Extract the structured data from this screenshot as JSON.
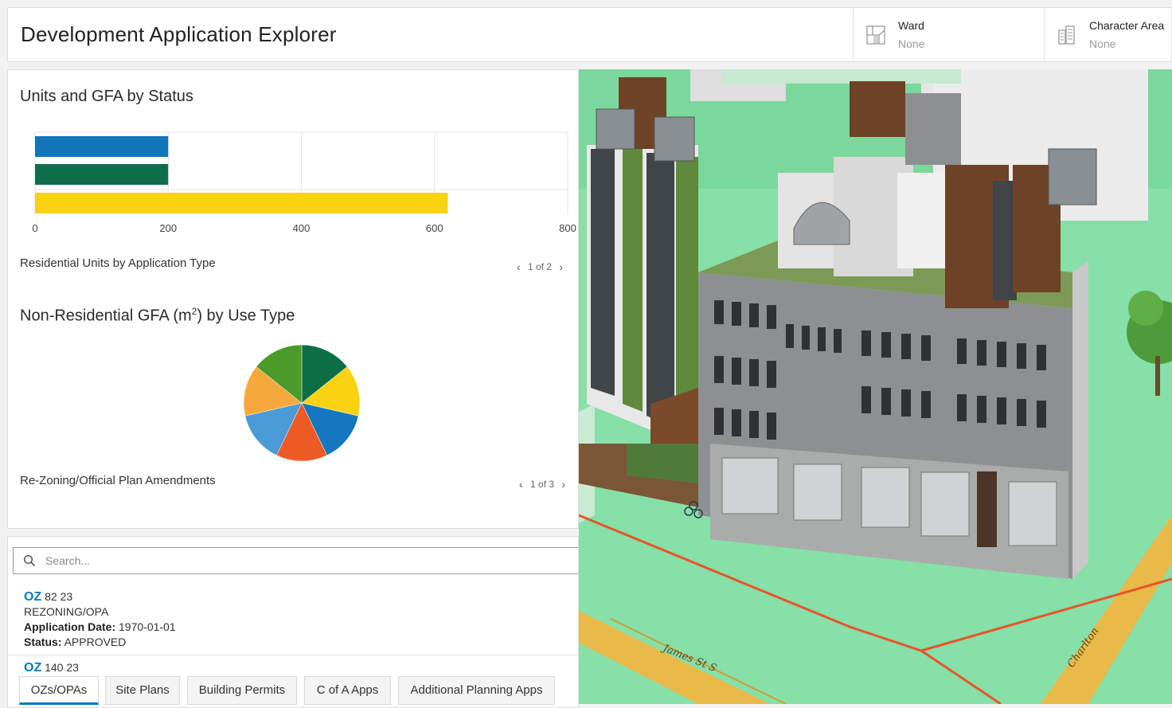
{
  "header": {
    "title": "Development Application Explorer",
    "selectors": [
      {
        "label": "Ward",
        "value": "None",
        "icon": "ward-map-icon"
      },
      {
        "label": "Character Area",
        "value": "None",
        "icon": "character-area-buildings-icon"
      }
    ]
  },
  "chart_section": {
    "title": "Units and GFA by Status",
    "chart_caption": "Residential Units by Application Type",
    "chart_pager": {
      "page": "1 of 2"
    },
    "pie_title_prefix": "Non-Residential GFA (m",
    "pie_title_sup": "2",
    "pie_title_suffix": ") by Use Type",
    "pie_caption": "Re-Zoning/Official Plan Amendments",
    "pie_pager": {
      "page": "1 of 3"
    }
  },
  "chart_data": [
    {
      "type": "bar",
      "orientation": "horizontal",
      "title": "Units and GFA by Status",
      "xlim": [
        0,
        800
      ],
      "ticks": [
        "0",
        "200",
        "400",
        "600",
        "800"
      ],
      "grid": true,
      "series": [
        {
          "values": [
            200
          ],
          "color": "#1175b8"
        },
        {
          "values": [
            200
          ],
          "color": "#0e6e4c"
        },
        {
          "values": [
            620
          ],
          "color": "#f7d312"
        }
      ]
    },
    {
      "type": "pie",
      "title": "Non-Residential GFA (m²) by Use Type",
      "values": [
        1,
        1,
        1,
        1,
        1,
        1,
        1
      ],
      "colors": [
        "#0d6e45",
        "#f7d312",
        "#1477c0",
        "#ee5a24",
        "#4a9ad7",
        "#f6a93b",
        "#4c9a2a"
      ]
    }
  ],
  "search": {
    "placeholder": "Search..."
  },
  "records": [
    {
      "code": "OZ",
      "number": "82 23",
      "type": "REZONING/OPA",
      "date_label": "Application Date:",
      "date": "1970-01-01",
      "status_label": "Status:",
      "status": "APPROVED"
    },
    {
      "code": "OZ",
      "number": "140 23"
    }
  ],
  "tabs": [
    {
      "label": "OZs/OPAs",
      "active": true
    },
    {
      "label": "Site Plans",
      "active": false
    },
    {
      "label": "Building Permits",
      "active": false
    },
    {
      "label": "C of A Apps",
      "active": false
    },
    {
      "label": "Additional Planning Apps",
      "active": false
    }
  ],
  "map": {
    "street_labels": [
      "James St S",
      "Charlton"
    ],
    "colors": {
      "ground": "#86e0a8",
      "road": "#e9b94a",
      "boundary": "#e8542a"
    }
  },
  "colors": {
    "accent": "#0079c1"
  }
}
